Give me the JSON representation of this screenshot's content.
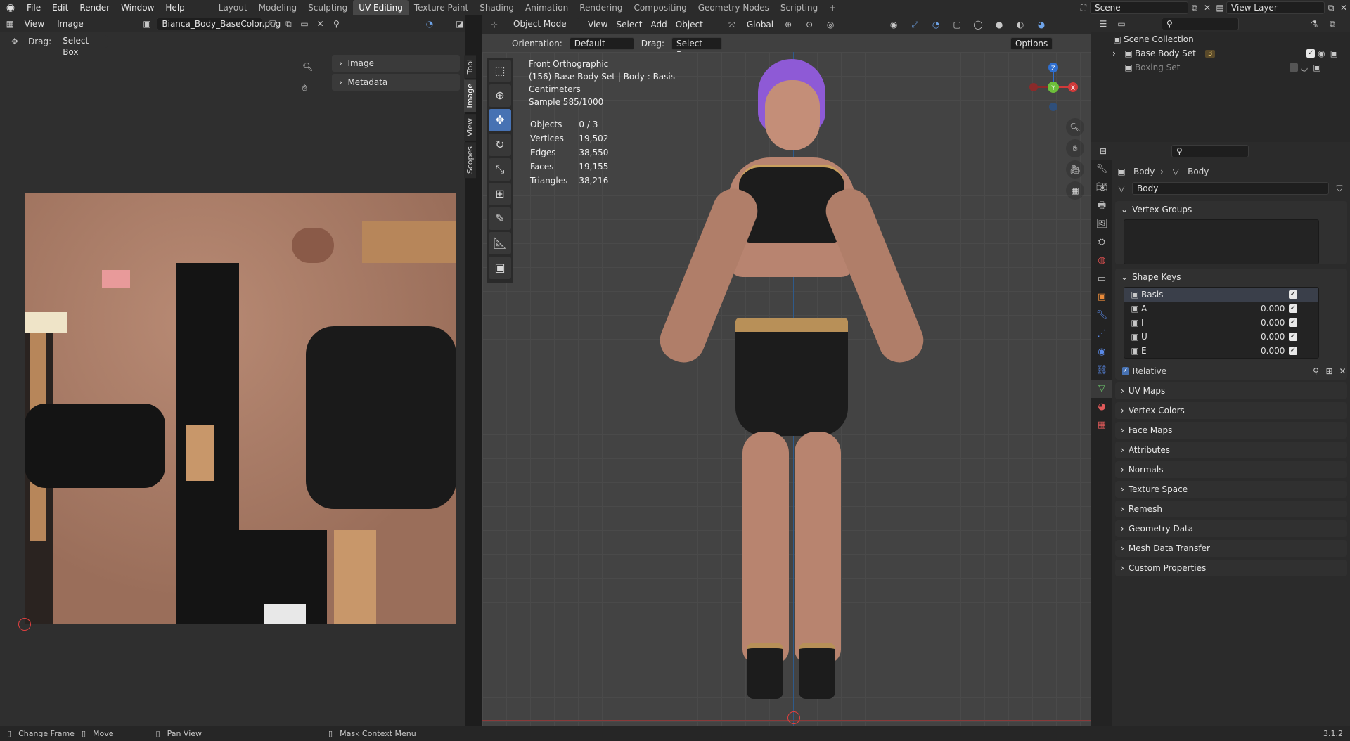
{
  "app": {
    "menu": [
      "File",
      "Edit",
      "Render",
      "Window",
      "Help"
    ],
    "workspaces": [
      "Layout",
      "Modeling",
      "Sculpting",
      "UV Editing",
      "Texture Paint",
      "Shading",
      "Animation",
      "Rendering",
      "Compositing",
      "Geometry Nodes",
      "Scripting"
    ],
    "active_workspace": "UV Editing",
    "scene": "Scene",
    "view_layer": "View Layer"
  },
  "uv_editor": {
    "menus": [
      "View",
      "Image"
    ],
    "image_name": "Bianca_Body_BaseColor.png",
    "drag_label": "Drag:",
    "drag_value": "Select Box",
    "panels": [
      "Image",
      "Metadata"
    ],
    "side_tabs": [
      "Tool",
      "Image",
      "View",
      "Scopes"
    ]
  },
  "viewport": {
    "mode": "Object Mode",
    "menus": [
      "View",
      "Select",
      "Add",
      "Object"
    ],
    "transform": "Global",
    "orientation_label": "Orientation:",
    "orientation_value": "Default",
    "drag_label": "Drag:",
    "drag_value": "Select Box",
    "options": "Options",
    "info_lines": [
      "Front Orthographic",
      "(156) Base Body Set | Body : Basis",
      "Centimeters",
      "Sample 585/1000"
    ],
    "stats": [
      {
        "label": "Objects",
        "value": "0 / 3"
      },
      {
        "label": "Vertices",
        "value": "19,502"
      },
      {
        "label": "Edges",
        "value": "38,550"
      },
      {
        "label": "Faces",
        "value": "19,155"
      },
      {
        "label": "Triangles",
        "value": "38,216"
      }
    ],
    "gizmo": {
      "x": "X",
      "y": "Y",
      "z": "Z"
    }
  },
  "outliner": {
    "root": "Scene Collection",
    "items": [
      {
        "name": "Base Body Set",
        "badge": "3"
      },
      {
        "name": "Boxing Set"
      }
    ]
  },
  "properties": {
    "breadcrumb": [
      "Body",
      "Body"
    ],
    "mesh_name": "Body",
    "vertex_groups": "Vertex Groups",
    "shape_keys": "Shape Keys",
    "keys": [
      {
        "name": "Basis",
        "value": ""
      },
      {
        "name": "A",
        "value": "0.000"
      },
      {
        "name": "I",
        "value": "0.000"
      },
      {
        "name": "U",
        "value": "0.000"
      },
      {
        "name": "E",
        "value": "0.000"
      }
    ],
    "relative": "Relative",
    "sections": [
      "UV Maps",
      "Vertex Colors",
      "Face Maps",
      "Attributes",
      "Normals",
      "Texture Space",
      "Remesh",
      "Geometry Data",
      "Mesh Data Transfer",
      "Custom Properties"
    ]
  },
  "status": {
    "items": [
      "Change Frame",
      "Move",
      "Pan View",
      "Mask Context Menu"
    ],
    "version": "3.1.2"
  }
}
